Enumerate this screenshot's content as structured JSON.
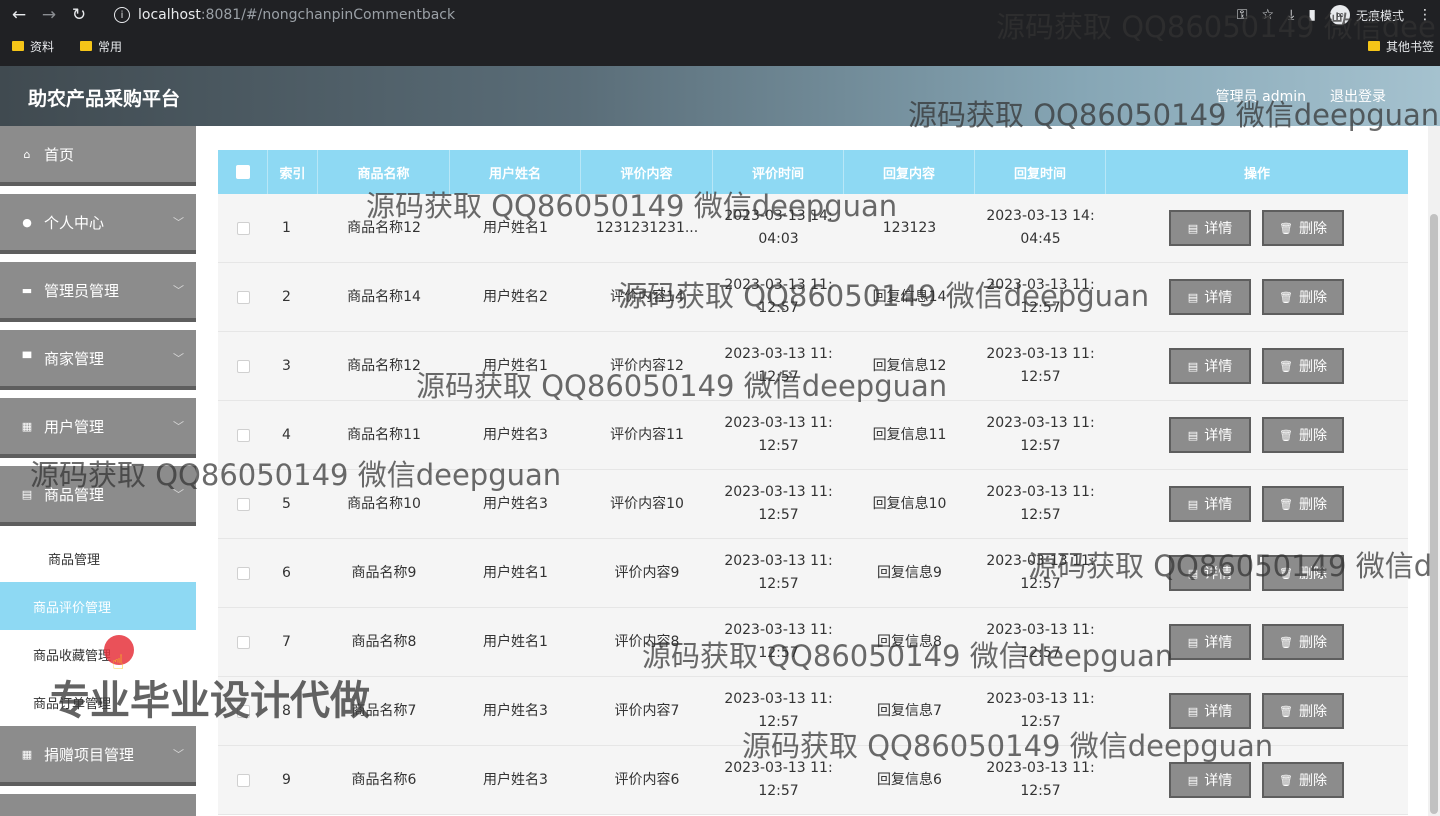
{
  "browser": {
    "url_host": "localhost",
    "url_path": ":8081/#/nongchanpinCommentback",
    "incognito_label": "无痕模式",
    "bookmarks": [
      "资料",
      "常用"
    ],
    "other_bookmarks": "其他书签"
  },
  "app": {
    "title": "助农产品采购平台",
    "user_label": "管理员 admin",
    "logout_label": "退出登录"
  },
  "sidebar": {
    "items": [
      {
        "label": "首页",
        "icon": "home-icon",
        "glyph": "⌂",
        "chevron": false
      },
      {
        "label": "个人中心",
        "icon": "user-icon",
        "glyph": "●",
        "chevron": true
      },
      {
        "label": "管理员管理",
        "icon": "monitor-icon",
        "glyph": "▬",
        "chevron": true
      },
      {
        "label": "商家管理",
        "icon": "briefcase-icon",
        "glyph": "▀",
        "chevron": true
      },
      {
        "label": "用户管理",
        "icon": "grid-icon",
        "glyph": "▦",
        "chevron": true
      },
      {
        "label": "商品管理",
        "icon": "doc-icon",
        "glyph": "▤",
        "chevron": true
      },
      {
        "label": "捐赠项目管理",
        "icon": "grid-icon",
        "glyph": "▦",
        "chevron": true
      }
    ],
    "sub_items": [
      "商品管理",
      "商品评价管理",
      "商品收藏管理",
      "商品订单管理"
    ]
  },
  "table": {
    "headers": [
      "索引",
      "商品名称",
      "用户姓名",
      "评价内容",
      "评价时间",
      "回复内容",
      "回复时间",
      "操作"
    ],
    "rows": [
      {
        "index": "1",
        "product": "商品名称12",
        "user": "用户姓名1",
        "comment": "1231231231...",
        "comment_time": "2023-03-13 14:\n04:03",
        "reply": "123123",
        "reply_time": "2023-03-13 14:\n04:45"
      },
      {
        "index": "2",
        "product": "商品名称14",
        "user": "用户姓名2",
        "comment": "评价内容14",
        "comment_time": "2023-03-13 11:\n12:57",
        "reply": "回复信息14",
        "reply_time": "2023-03-13 11:\n12:57"
      },
      {
        "index": "3",
        "product": "商品名称12",
        "user": "用户姓名1",
        "comment": "评价内容12",
        "comment_time": "2023-03-13 11:\n12:57",
        "reply": "回复信息12",
        "reply_time": "2023-03-13 11:\n12:57"
      },
      {
        "index": "4",
        "product": "商品名称11",
        "user": "用户姓名3",
        "comment": "评价内容11",
        "comment_time": "2023-03-13 11:\n12:57",
        "reply": "回复信息11",
        "reply_time": "2023-03-13 11:\n12:57"
      },
      {
        "index": "5",
        "product": "商品名称10",
        "user": "用户姓名3",
        "comment": "评价内容10",
        "comment_time": "2023-03-13 11:\n12:57",
        "reply": "回复信息10",
        "reply_time": "2023-03-13 11:\n12:57"
      },
      {
        "index": "6",
        "product": "商品名称9",
        "user": "用户姓名1",
        "comment": "评价内容9",
        "comment_time": "2023-03-13 11:\n12:57",
        "reply": "回复信息9",
        "reply_time": "2023-03-13 11:\n12:57"
      },
      {
        "index": "7",
        "product": "商品名称8",
        "user": "用户姓名1",
        "comment": "评价内容8",
        "comment_time": "2023-03-13 11:\n12:57",
        "reply": "回复信息8",
        "reply_time": "2023-03-13 11:\n12:57"
      },
      {
        "index": "8",
        "product": "商品名称7",
        "user": "用户姓名3",
        "comment": "评价内容7",
        "comment_time": "2023-03-13 11:\n12:57",
        "reply": "回复信息7",
        "reply_time": "2023-03-13 11:\n12:57"
      },
      {
        "index": "9",
        "product": "商品名称6",
        "user": "用户姓名3",
        "comment": "评价内容6",
        "comment_time": "2023-03-13 11:\n12:57",
        "reply": "回复信息6",
        "reply_time": "2023-03-13 11:\n12:57"
      }
    ],
    "detail_label": "详情",
    "delete_label": "删除"
  },
  "watermarks": {
    "text": "源码获取 QQ86050149 微信deepguan",
    "text_cut_1": "源码获取 QQ86050149 微信dee",
    "text_cut_2": "源码获取 QQ86050149 微信d",
    "promo": "专业毕业设计代做"
  },
  "colors": {
    "accent": "#8ed9f3",
    "sidebar": "#8c8c8c",
    "button": "#8c8c8c"
  }
}
